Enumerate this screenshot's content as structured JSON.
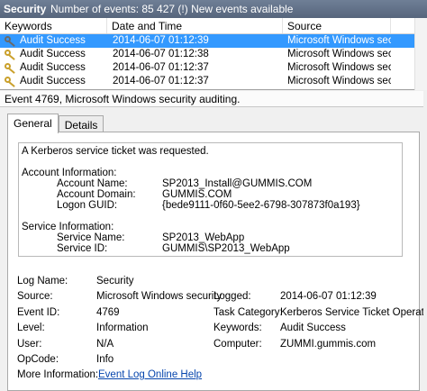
{
  "titlebar": {
    "name": "Security",
    "count": "Number of events: 85 427 (!) New events available"
  },
  "grid": {
    "columns": [
      "Keywords",
      "Date and Time",
      "Source"
    ],
    "rows": [
      {
        "keyword": "Audit Success",
        "datetime": "2014-06-07 01:12:39",
        "source": "Microsoft Windows sec...",
        "selected": true
      },
      {
        "keyword": "Audit Success",
        "datetime": "2014-06-07 01:12:38",
        "source": "Microsoft Windows sec...",
        "selected": false
      },
      {
        "keyword": "Audit Success",
        "datetime": "2014-06-07 01:12:37",
        "source": "Microsoft Windows sec...",
        "selected": false
      },
      {
        "keyword": "Audit Success",
        "datetime": "2014-06-07 01:12:37",
        "source": "Microsoft Windows sec...",
        "selected": false
      }
    ]
  },
  "event_header": "Event 4769, Microsoft Windows security auditing.",
  "tabs": [
    "General",
    "Details"
  ],
  "message": {
    "intro": "A Kerberos service ticket was requested.",
    "account_section": "Account Information:",
    "account_name_label": "Account Name:",
    "account_name": "SP2013_Install@GUMMIS.COM",
    "account_domain_label": "Account Domain:",
    "account_domain": "GUMMIS.COM",
    "logon_guid_label": "Logon GUID:",
    "logon_guid": "{bede9111-0f60-5ee2-6798-307873f0a193}",
    "service_section": "Service Information:",
    "service_name_label": "Service Name:",
    "service_name": "SP2013_WebApp",
    "service_id_label": "Service ID:",
    "service_id": "GUMMIS\\SP2013_WebApp"
  },
  "properties": {
    "log_name_label": "Log Name:",
    "log_name": "Security",
    "source_label": "Source:",
    "source": "Microsoft Windows security",
    "logged_label": "Logged:",
    "logged": "2014-06-07 01:12:39",
    "event_id_label": "Event ID:",
    "event_id": "4769",
    "task_category_label": "Task Category:",
    "task_category": "Kerberos Service Ticket Operations",
    "level_label": "Level:",
    "level": "Information",
    "keywords_label": "Keywords:",
    "keywords": "Audit Success",
    "user_label": "User:",
    "user": "N/A",
    "computer_label": "Computer:",
    "computer": "ZUMMI.gummis.com",
    "opcode_label": "OpCode:",
    "opcode": "Info",
    "more_info_label": "More Information:",
    "more_info_link": "Event Log Online Help"
  },
  "colors": {
    "selection": "#3399ff",
    "titlebar": "#5f6e85",
    "link": "#0645ad"
  }
}
